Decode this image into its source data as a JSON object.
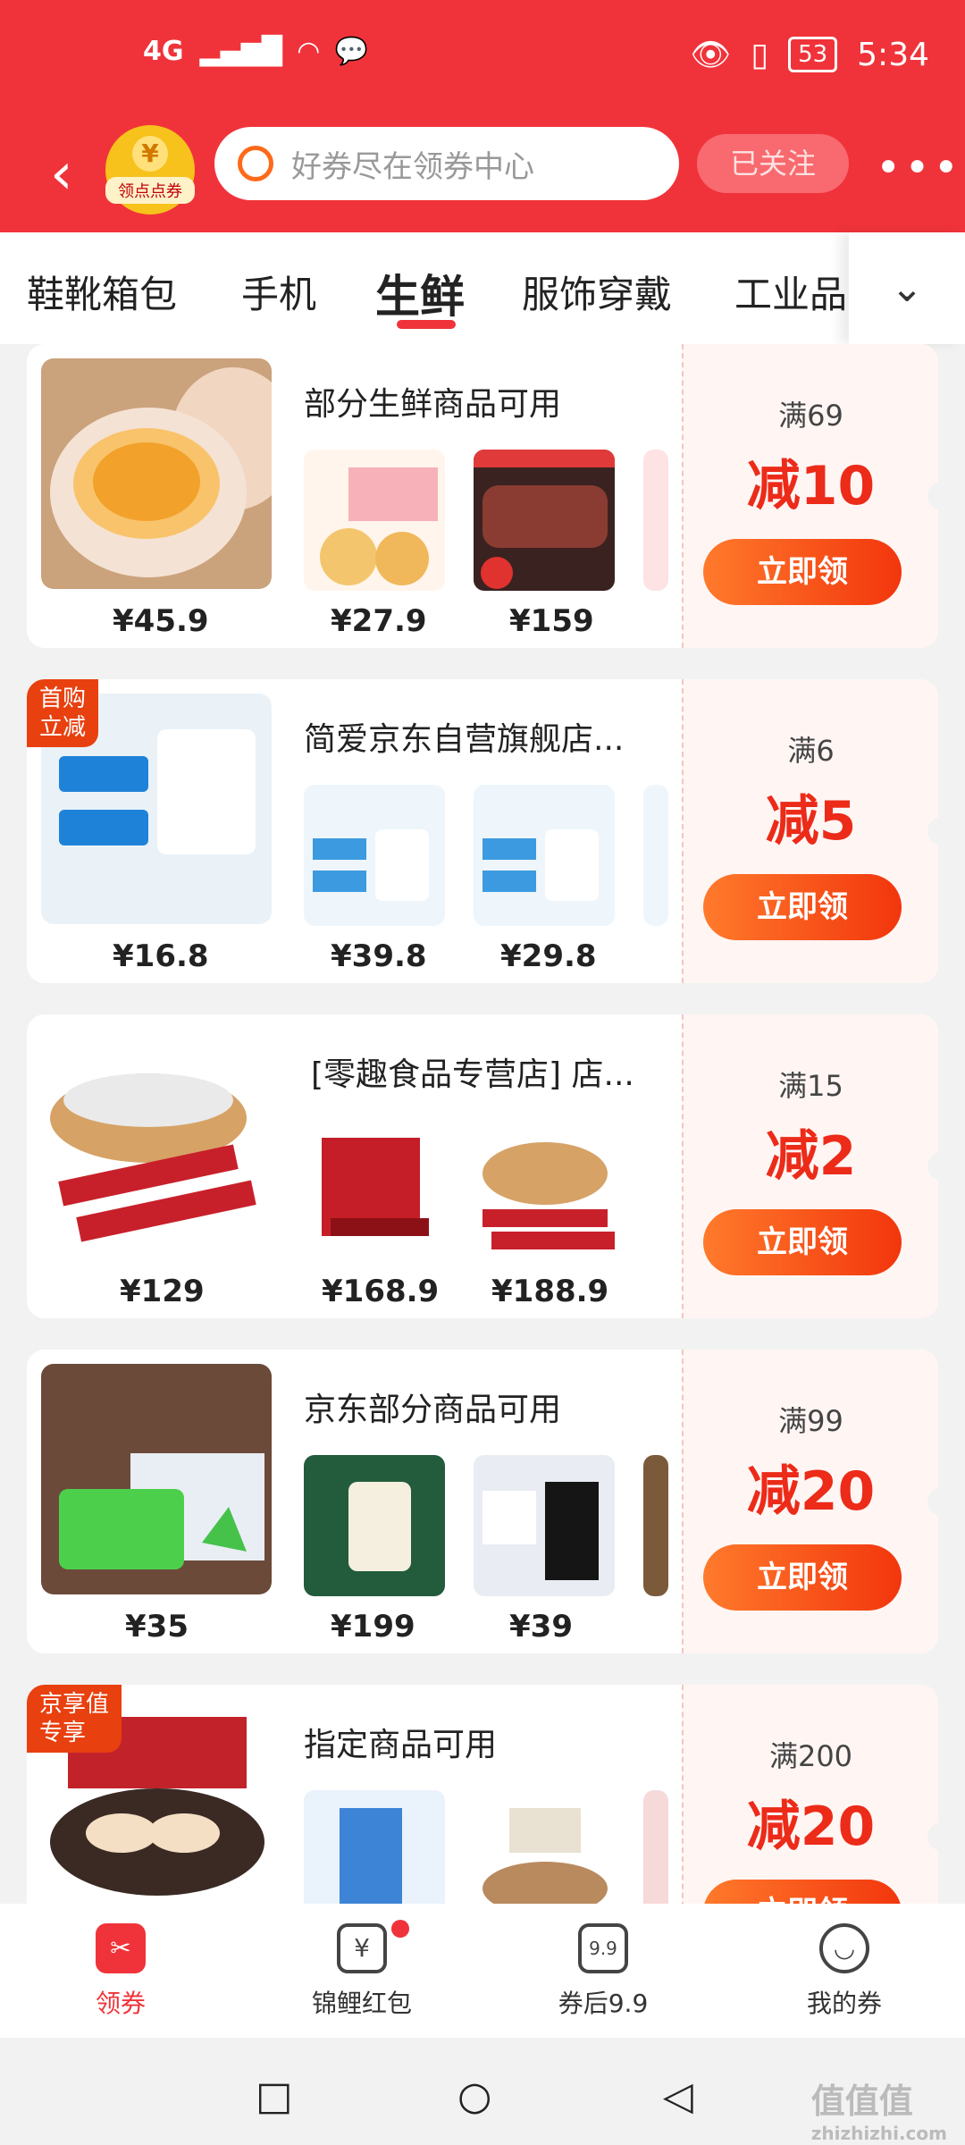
{
  "status_bar": {
    "network": "4G",
    "battery": "53",
    "time": "5:34"
  },
  "header": {
    "logo_label": "领点点券",
    "logo_coin": "¥",
    "search_placeholder": "好券尽在领券中心",
    "follow_label": "已关注",
    "more_label": "•••"
  },
  "tabs": [
    {
      "label": "鞋靴箱包"
    },
    {
      "label": "手机"
    },
    {
      "label": "生鲜",
      "active": true
    },
    {
      "label": "服饰穿戴"
    },
    {
      "label": "工业品"
    }
  ],
  "cards": [
    {
      "title": "部分生鲜商品可用",
      "main_price": "¥45.9",
      "thumb_prices": [
        "¥27.9",
        "¥159"
      ],
      "coupon_condition": "满69",
      "coupon_discount": "减10",
      "coupon_button": "立即领",
      "badge": ""
    },
    {
      "title": "简爱京东自营旗舰店...",
      "main_price": "¥16.8",
      "thumb_prices": [
        "¥39.8",
        "¥29.8"
      ],
      "coupon_condition": "满6",
      "coupon_discount": "减5",
      "coupon_button": "立即领",
      "badge": "首购\n立减"
    },
    {
      "title": "[零趣食品专营店] 店...",
      "main_price": "¥129",
      "thumb_prices": [
        "¥168.9",
        "¥188.9"
      ],
      "coupon_condition": "满15",
      "coupon_discount": "减2",
      "coupon_button": "立即领",
      "badge": ""
    },
    {
      "title": "京东部分商品可用",
      "main_price": "¥35",
      "thumb_prices": [
        "¥199",
        "¥39"
      ],
      "coupon_condition": "满99",
      "coupon_discount": "减20",
      "coupon_button": "立即领",
      "badge": ""
    },
    {
      "title": "指定商品可用",
      "main_price": "",
      "thumb_prices": [
        "",
        ""
      ],
      "coupon_condition": "满200",
      "coupon_discount": "减20",
      "coupon_button": "立即领",
      "badge": "京享值\n专享"
    }
  ],
  "bottom_nav": [
    {
      "label": "领券",
      "active": true,
      "icon": "coupon-icon"
    },
    {
      "label": "锦鲤红包",
      "icon": "red-envelope-icon",
      "dot": true
    },
    {
      "label": "券后9.9",
      "icon": "price-tag-icon",
      "icon_text": "9.9"
    },
    {
      "label": "我的券",
      "icon": "smile-icon"
    }
  ],
  "watermark": {
    "main": "值值值",
    "sub": "zhizhizhi.com"
  },
  "colors": {
    "brand_red": "#f0333a",
    "coupon_orange": "#ec2b19"
  }
}
